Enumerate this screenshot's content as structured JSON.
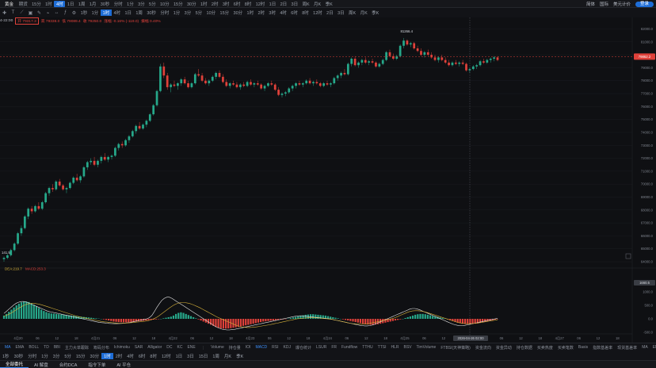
{
  "header": {
    "symbol": "黄金",
    "market": "期货",
    "timeframes": [
      "15分",
      "1时",
      "4时",
      "1日",
      "1周",
      "1月",
      "30秒",
      "分时",
      "1分",
      "3分",
      "5分",
      "10分",
      "15分",
      "30分",
      "1时",
      "2时",
      "3时",
      "6时",
      "8时",
      "12时",
      "1日",
      "2日",
      "3日",
      "周K",
      "月K",
      "季K"
    ],
    "active_tf": 2,
    "right_items": [
      "简体",
      "国际",
      "美元计价",
      "登录"
    ]
  },
  "toolbar": {
    "icons": [
      "crosshair-icon",
      "text-icon",
      "draw-icon",
      "lock-icon",
      "pen-icon",
      "link-icon",
      "measure-icon",
      "indicator-icon",
      "settings-icon"
    ],
    "timeframes": [
      "1秒",
      "1分",
      "1时",
      "4时",
      "1日",
      "1周",
      "30秒",
      "分时",
      "1分",
      "3分",
      "5分",
      "10分",
      "15分",
      "30分",
      "1时",
      "2时",
      "3时",
      "4时",
      "6时",
      "8时",
      "12时",
      "2日",
      "3日",
      "周K",
      "月K",
      "季K"
    ],
    "active_tf": 2
  },
  "info": {
    "time": "4-22:00",
    "open": "开 79317.3",
    "high": "高 79338.0",
    "low": "低 79089.4",
    "close": "收 79250.0",
    "change": "涨幅 -0.16% (-119.0)",
    "amp": "振幅 0.40%"
  },
  "price_axis": {
    "ticks": [
      "82000.0",
      "81000.0",
      "80000.0",
      "79000.0",
      "78000.0",
      "77000.0",
      "76000.0",
      "75000.0",
      "74000.0",
      "73000.0",
      "72000.0",
      "71000.0",
      "70000.0",
      "69000.0",
      "68000.0",
      "67000.0",
      "66000.0",
      "65000.0",
      "64000.0"
    ],
    "current": "79862.2",
    "high_label": "81266.4",
    "low_label": "141.5",
    "cursor_date": "2026-04-26 02:00"
  },
  "macd": {
    "label_dea": "DEA:219.7",
    "label_macd": "MACD:253.3",
    "ticks": [
      "1000.0",
      "500.0",
      "0.0",
      "-500.0",
      "-1000.0"
    ],
    "current": "1660.5",
    "hist": [
      120,
      180,
      260,
      340,
      420,
      500,
      560,
      610,
      640,
      640,
      620,
      580,
      520,
      460,
      400,
      340,
      290,
      250,
      220,
      200,
      190,
      180,
      170,
      160,
      150,
      140,
      130,
      120,
      110,
      100,
      90,
      80,
      70,
      60,
      50,
      40,
      30,
      20,
      10,
      0,
      -20,
      -40,
      -60,
      -80,
      -100,
      -110,
      -120,
      -125,
      -130,
      -130,
      -128,
      -120,
      -110,
      -100,
      -90,
      -80,
      -70,
      -60,
      -50,
      -40,
      -30,
      -20,
      -10,
      0,
      20,
      40,
      60,
      80,
      120,
      180,
      220,
      240,
      220,
      180,
      140,
      100,
      60,
      20,
      -20,
      -60,
      -100,
      -140,
      -180,
      -220,
      -260,
      -300,
      -330,
      -350,
      -360,
      -360,
      -355,
      -345,
      -330,
      -315,
      -300,
      -280,
      -260,
      -240,
      -220,
      -200,
      -180,
      -160,
      -140,
      -120,
      -100,
      -90,
      -80,
      -70,
      -60,
      -50,
      -40,
      -30,
      -20,
      -10,
      10,
      30,
      50,
      70,
      90,
      110,
      130,
      150,
      160,
      170,
      170,
      160,
      150,
      140,
      130,
      120,
      100,
      80,
      60,
      40,
      20,
      0,
      -20,
      -40,
      -60,
      -80,
      -100,
      -120,
      -140,
      -160,
      -180,
      -200,
      -210,
      -220,
      -220,
      -210,
      -200,
      -180,
      -160,
      -140,
      -120,
      -100,
      -80,
      -60,
      -40,
      -20,
      0,
      30,
      60,
      90,
      120,
      150,
      170,
      180,
      180,
      170,
      150,
      130,
      110,
      90,
      70,
      50,
      30,
      10,
      -20,
      -50,
      -80,
      -110,
      -140,
      -160,
      -180,
      -190,
      -195,
      -195,
      -190,
      -180,
      -170,
      -150,
      -130,
      -110,
      -90,
      -70,
      -50,
      -30,
      -10
    ],
    "dif": [
      200,
      280,
      360,
      440,
      520,
      580,
      620,
      640,
      640,
      620,
      580,
      540,
      500,
      460,
      420,
      380,
      340,
      300,
      270,
      250,
      230,
      210,
      190,
      170,
      150,
      130,
      110,
      90,
      70,
      50,
      30,
      10,
      -10,
      -30,
      -50,
      -70,
      -90,
      -110,
      -130,
      -140,
      -150,
      -160,
      -170,
      -175,
      -180,
      -180,
      -175,
      -170,
      -160,
      -150,
      -140,
      -120,
      -100,
      -80,
      -60,
      -40,
      -20,
      0,
      40,
      120,
      260,
      420,
      560,
      680,
      760,
      800,
      800,
      760,
      700,
      640,
      580,
      520,
      460,
      400,
      340,
      280,
      220,
      160,
      100,
      40,
      -20,
      -80,
      -140,
      -200,
      -260,
      -310,
      -350,
      -380,
      -400,
      -410,
      -410,
      -400,
      -390,
      -370,
      -350,
      -330,
      -310,
      -290,
      -270,
      -250,
      -230,
      -210,
      -190,
      -170,
      -150,
      -130,
      -110,
      -90,
      -70,
      -50,
      -30,
      -10,
      10,
      30,
      50,
      70,
      90,
      100,
      110,
      110,
      100,
      90,
      80,
      70,
      60,
      50,
      40,
      30,
      20,
      10,
      0,
      -20,
      -40,
      -60,
      -80,
      -100,
      -120,
      -140,
      -160,
      -180,
      -200,
      -220,
      -240,
      -250,
      -260,
      -260,
      -250,
      -230,
      -200,
      -160,
      -120,
      -80,
      -40,
      0,
      40,
      80,
      120,
      160,
      200,
      240,
      280,
      320,
      360,
      380,
      380,
      360,
      330,
      290,
      250,
      210,
      170,
      130,
      90,
      50,
      10,
      -30,
      -70,
      -110,
      -150,
      -190,
      -220,
      -240,
      -250,
      -250,
      -240,
      -220,
      -200,
      -180,
      -160,
      -140,
      -120,
      -100,
      -80,
      -60,
      -40,
      -20,
      0,
      20
    ],
    "dea": [
      100,
      130,
      170,
      220,
      280,
      340,
      400,
      450,
      500,
      540,
      560,
      570,
      570,
      560,
      540,
      520,
      490,
      460,
      430,
      400,
      370,
      340,
      310,
      280,
      250,
      220,
      190,
      160,
      130,
      100,
      80,
      60,
      40,
      20,
      0,
      -20,
      -40,
      -60,
      -80,
      -100,
      -110,
      -120,
      -130,
      -140,
      -150,
      -155,
      -160,
      -160,
      -158,
      -155,
      -150,
      -140,
      -130,
      -120,
      -110,
      -100,
      -90,
      -80,
      -60,
      -30,
      10,
      60,
      120,
      190,
      260,
      330,
      400,
      460,
      520,
      560,
      590,
      600,
      600,
      590,
      570,
      540,
      500,
      460,
      420,
      370,
      320,
      270,
      220,
      170,
      120,
      70,
      30,
      -10,
      -50,
      -90,
      -130,
      -170,
      -210,
      -250,
      -280,
      -300,
      -310,
      -320,
      -320,
      -315,
      -305,
      -295,
      -280,
      -265,
      -250,
      -235,
      -220,
      -200,
      -180,
      -160,
      -140,
      -120,
      -100,
      -80,
      -60,
      -40,
      -20,
      0,
      10,
      20,
      30,
      35,
      40,
      40,
      40,
      35,
      30,
      20,
      10,
      0,
      -10,
      -20,
      -40,
      -60,
      -80,
      -100,
      -120,
      -140,
      -160,
      -175,
      -185,
      -195,
      -200,
      -200,
      -195,
      -185,
      -170,
      -150,
      -130,
      -110,
      -90,
      -70,
      -50,
      -30,
      -10,
      10,
      40,
      80,
      120,
      160,
      200,
      240,
      270,
      290,
      300,
      300,
      290,
      275,
      255,
      230,
      200,
      170,
      140,
      110,
      80,
      50,
      20,
      -10,
      -40,
      -70,
      -100,
      -130,
      -150,
      -165,
      -175,
      -180,
      -180,
      -175,
      -165,
      -155,
      -140,
      -125,
      -110,
      -95,
      -80,
      -65,
      -50,
      -35
    ]
  },
  "time_axis": [
    "4月20",
    "06",
    "12",
    "18",
    "4月21",
    "06",
    "12",
    "18",
    "4月22",
    "06",
    "12",
    "18",
    "4月23",
    "06",
    "12",
    "18",
    "4月24",
    "06",
    "12",
    "18",
    "4月25",
    "06",
    "12",
    "18",
    "4月26",
    "06",
    "12",
    "18",
    "4月27",
    "06",
    "12",
    "18",
    "4月28"
  ],
  "indicators_main": [
    "MA",
    "EMA",
    "BOLL",
    "TD",
    "BBI",
    "主力大单跟踪",
    "筹码分布",
    "Ichimoku",
    "SAR",
    "Alligator",
    "DC",
    "KC",
    "ENE"
  ],
  "indicators_sub": [
    "Volume",
    "持仓量",
    "IOI",
    "MACD",
    "RSI",
    "KDJ",
    "爆仓统计",
    "LSUR",
    "FR",
    "Fundflow",
    "TTHU",
    "TTSI",
    "HLR",
    "BSV",
    "TimVolume",
    "FTBSI(天神策略)",
    "资金流向",
    "资金异动",
    "持仓数据",
    "买卖热度",
    "买卖笔数",
    "Basis",
    "指数基差率",
    "现货基差率",
    "MA",
    "EMA",
    "AO",
    "ATR",
    "CCI",
    "DMI"
  ],
  "active_sub": "MACD",
  "bottom_timeframes": [
    "1秒",
    "30秒",
    "分时",
    "1分",
    "3分",
    "5分",
    "15分",
    "30分",
    "1时",
    "2时",
    "4时",
    "6时",
    "8时",
    "12时",
    "1日",
    "3日",
    "15日",
    "1周",
    "月K",
    "季K"
  ],
  "active_bottom_tf": 8,
  "footer_tabs": [
    "全部委托",
    "AI 解盘",
    "合约DCA",
    "指令下单",
    "AI 平仓"
  ],
  "candles": [
    [
      64200,
      64400,
      64000,
      64300
    ],
    [
      64300,
      64600,
      64200,
      64500
    ],
    [
      64500,
      65000,
      64400,
      64900
    ],
    [
      64900,
      65500,
      64800,
      65400
    ],
    [
      65400,
      66300,
      65300,
      66200
    ],
    [
      66200,
      66800,
      66000,
      66600
    ],
    [
      66600,
      67600,
      66500,
      67500
    ],
    [
      67500,
      68200,
      67300,
      68100
    ],
    [
      68100,
      68300,
      67700,
      67900
    ],
    [
      67900,
      68400,
      67800,
      68300
    ],
    [
      68300,
      68600,
      68000,
      68100
    ],
    [
      68100,
      68700,
      68000,
      68600
    ],
    [
      68600,
      69400,
      68500,
      69300
    ],
    [
      69300,
      69800,
      69100,
      69700
    ],
    [
      69700,
      70000,
      69400,
      69600
    ],
    [
      69600,
      70300,
      69500,
      70200
    ],
    [
      70200,
      70400,
      69800,
      69900
    ],
    [
      69900,
      70000,
      69500,
      69600
    ],
    [
      69600,
      69800,
      69300,
      69700
    ],
    [
      69700,
      70200,
      69600,
      70100
    ],
    [
      70100,
      70600,
      70000,
      70500
    ],
    [
      70500,
      70800,
      70200,
      70300
    ],
    [
      70300,
      70700,
      70100,
      70600
    ],
    [
      70600,
      71400,
      70500,
      71300
    ],
    [
      71300,
      71800,
      71100,
      71700
    ],
    [
      71700,
      72000,
      71500,
      71800
    ],
    [
      71800,
      72100,
      71400,
      71500
    ],
    [
      71500,
      71900,
      71300,
      71800
    ],
    [
      71800,
      72200,
      71600,
      72100
    ],
    [
      72100,
      72400,
      71800,
      71900
    ],
    [
      71900,
      72200,
      71700,
      72100
    ],
    [
      72100,
      72300,
      71900,
      72200
    ],
    [
      72200,
      72900,
      72100,
      72800
    ],
    [
      72800,
      73200,
      72600,
      73100
    ],
    [
      73100,
      73300,
      72800,
      73000
    ],
    [
      73000,
      73500,
      72900,
      73400
    ],
    [
      73400,
      73800,
      73200,
      73700
    ],
    [
      73700,
      74200,
      73600,
      74100
    ],
    [
      74100,
      74600,
      73900,
      74500
    ],
    [
      74500,
      74800,
      74200,
      74300
    ],
    [
      74300,
      74700,
      74200,
      74600
    ],
    [
      74600,
      75000,
      74400,
      74900
    ],
    [
      74900,
      75500,
      74800,
      75400
    ],
    [
      75400,
      76200,
      75300,
      76100
    ],
    [
      76100,
      77300,
      76000,
      77200
    ],
    [
      77200,
      79300,
      77100,
      79100
    ],
    [
      79100,
      79400,
      78200,
      78400
    ],
    [
      78400,
      78600,
      77300,
      77500
    ],
    [
      77500,
      77800,
      77100,
      77700
    ],
    [
      77700,
      78000,
      77500,
      77600
    ],
    [
      77600,
      77900,
      77300,
      77800
    ],
    [
      77800,
      78200,
      77600,
      78100
    ],
    [
      78100,
      78300,
      77700,
      77800
    ],
    [
      77800,
      78000,
      77400,
      77500
    ],
    [
      77500,
      77900,
      77400,
      77800
    ],
    [
      77800,
      78600,
      77700,
      78500
    ],
    [
      78500,
      78900,
      78300,
      78400
    ],
    [
      78400,
      78600,
      77900,
      78000
    ],
    [
      78000,
      78200,
      77700,
      77800
    ],
    [
      77800,
      78100,
      77600,
      78000
    ],
    [
      78000,
      78400,
      77900,
      78300
    ],
    [
      78300,
      78700,
      78100,
      78600
    ],
    [
      78600,
      78800,
      78200,
      78300
    ],
    [
      78300,
      78500,
      77800,
      77900
    ],
    [
      77900,
      78100,
      77500,
      77600
    ],
    [
      77600,
      77900,
      77400,
      77800
    ],
    [
      77800,
      78000,
      77600,
      77700
    ],
    [
      77700,
      77900,
      77400,
      77500
    ],
    [
      77500,
      77800,
      77300,
      77700
    ],
    [
      77700,
      77900,
      77500,
      77600
    ],
    [
      77600,
      78000,
      77500,
      77900
    ],
    [
      77900,
      78100,
      77600,
      77700
    ],
    [
      77700,
      77900,
      77500,
      77800
    ],
    [
      77800,
      78000,
      77600,
      77700
    ],
    [
      77700,
      77800,
      77300,
      77400
    ],
    [
      77400,
      77700,
      77200,
      77600
    ],
    [
      77600,
      77900,
      77500,
      77800
    ],
    [
      77800,
      78000,
      77600,
      77700
    ],
    [
      77700,
      77800,
      77200,
      77300
    ],
    [
      77300,
      77500,
      76800,
      76900
    ],
    [
      76900,
      77100,
      76700,
      77000
    ],
    [
      77000,
      77200,
      76800,
      77100
    ],
    [
      77100,
      77500,
      77000,
      77400
    ],
    [
      77400,
      77700,
      77200,
      77600
    ],
    [
      77600,
      77900,
      77400,
      77800
    ],
    [
      77800,
      78000,
      77600,
      77700
    ],
    [
      77700,
      77900,
      77500,
      77800
    ],
    [
      77800,
      78100,
      77700,
      78000
    ],
    [
      78000,
      78200,
      77700,
      77800
    ],
    [
      77800,
      78000,
      77600,
      77900
    ],
    [
      77900,
      78100,
      77700,
      77800
    ],
    [
      77800,
      77900,
      77500,
      77600
    ],
    [
      77600,
      77900,
      77500,
      77800
    ],
    [
      77800,
      78000,
      77600,
      77700
    ],
    [
      77700,
      77900,
      77500,
      77800
    ],
    [
      77800,
      78300,
      77700,
      78200
    ],
    [
      78200,
      78500,
      78000,
      78400
    ],
    [
      78400,
      78700,
      78200,
      78600
    ],
    [
      78600,
      78900,
      78400,
      78500
    ],
    [
      78500,
      79400,
      78400,
      79300
    ],
    [
      79300,
      79800,
      79100,
      79700
    ],
    [
      79700,
      79900,
      79100,
      79200
    ],
    [
      79200,
      79500,
      79000,
      79400
    ],
    [
      79400,
      79700,
      79200,
      79600
    ],
    [
      79600,
      79800,
      79300,
      79400
    ],
    [
      79400,
      79600,
      79200,
      79500
    ],
    [
      79500,
      79700,
      79300,
      79400
    ],
    [
      79400,
      79500,
      79000,
      79100
    ],
    [
      79100,
      79400,
      79000,
      79300
    ],
    [
      79300,
      79700,
      79200,
      79600
    ],
    [
      79600,
      80300,
      79500,
      80200
    ],
    [
      80200,
      80400,
      79800,
      79900
    ],
    [
      79900,
      80100,
      79600,
      79700
    ],
    [
      79700,
      80000,
      79600,
      79900
    ],
    [
      79900,
      80800,
      79800,
      80700
    ],
    [
      80700,
      81300,
      80500,
      81100
    ],
    [
      81100,
      81200,
      80700,
      80800
    ],
    [
      80800,
      81000,
      80600,
      80900
    ],
    [
      80900,
      81000,
      80400,
      80500
    ],
    [
      80500,
      80700,
      80200,
      80300
    ],
    [
      80300,
      80500,
      79900,
      80000
    ],
    [
      80000,
      80300,
      79800,
      80200
    ],
    [
      80200,
      80400,
      79900,
      80000
    ],
    [
      80000,
      80200,
      79700,
      79800
    ],
    [
      79800,
      80000,
      79500,
      79600
    ],
    [
      79600,
      79900,
      79400,
      79800
    ],
    [
      79800,
      80000,
      79500,
      79600
    ],
    [
      79600,
      79800,
      79300,
      79400
    ],
    [
      79400,
      79600,
      79100,
      79200
    ],
    [
      79200,
      79500,
      79100,
      79400
    ],
    [
      79400,
      79600,
      79200,
      79300
    ],
    [
      79300,
      79500,
      79100,
      79400
    ],
    [
      79400,
      79600,
      79200,
      79300
    ],
    [
      79300,
      79400,
      78700,
      78800
    ],
    [
      78800,
      79000,
      78600,
      78900
    ],
    [
      78900,
      79200,
      78800,
      79100
    ],
    [
      79100,
      79300,
      78900,
      79200
    ],
    [
      79200,
      79600,
      79100,
      79500
    ],
    [
      79500,
      79700,
      79300,
      79400
    ],
    [
      79400,
      79700,
      79300,
      79600
    ],
    [
      79600,
      79800,
      79400,
      79700
    ],
    [
      79700,
      79900,
      79500,
      79800
    ],
    [
      79800,
      79900,
      79500,
      79600
    ]
  ]
}
